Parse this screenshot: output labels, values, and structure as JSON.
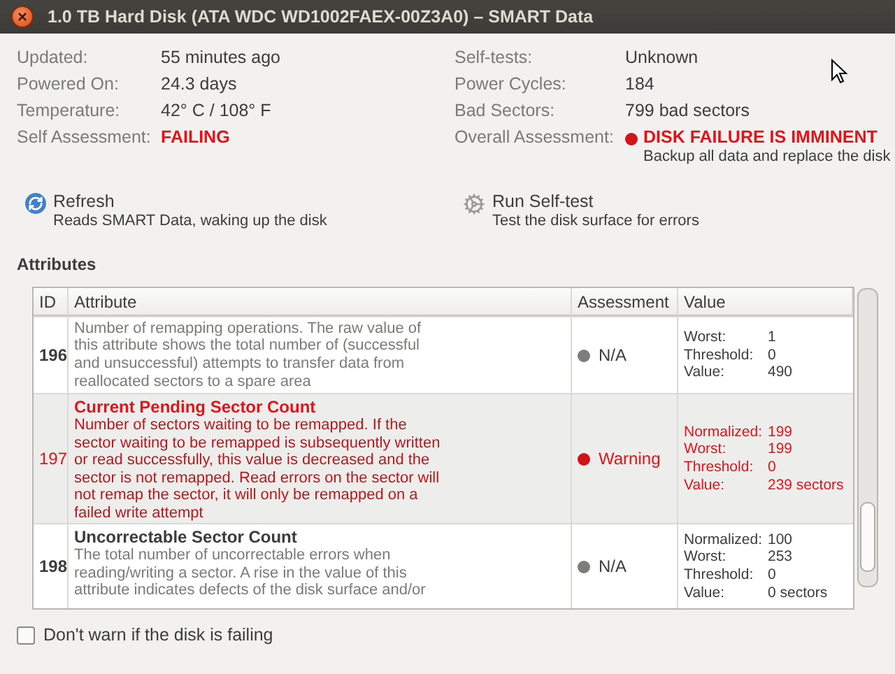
{
  "window": {
    "title": "1.0 TB Hard Disk (ATA WDC WD1002FAEX-00Z3A0) – SMART Data"
  },
  "info_left": [
    {
      "label": "Updated:",
      "value": "55 minutes ago",
      "alert": false
    },
    {
      "label": "Powered On:",
      "value": "24.3 days",
      "alert": false
    },
    {
      "label": "Temperature:",
      "value": "42° C / 108° F",
      "alert": false
    },
    {
      "label": "Self Assessment:",
      "value": "FAILING",
      "alert": true
    }
  ],
  "info_right": [
    {
      "label": "Self-tests:",
      "value": "Unknown",
      "alert": false
    },
    {
      "label": "Power Cycles:",
      "value": "184",
      "alert": false
    },
    {
      "label": "Bad Sectors:",
      "value": "799 bad sectors",
      "alert": false
    },
    {
      "label": "Overall Assessment:",
      "value": "DISK FAILURE IS IMMINENT",
      "note": "Backup all data and replace the disk",
      "alert": true
    }
  ],
  "actions": [
    {
      "kind": "refresh",
      "label": "Refresh",
      "description": "Reads SMART Data, waking up the disk"
    },
    {
      "kind": "selftest",
      "label": "Run Self-test",
      "description": "Test the disk surface for errors"
    }
  ],
  "attributes": {
    "heading": "Attributes",
    "columns": [
      "ID",
      "Attribute",
      "Assessment",
      "Value"
    ],
    "rows": [
      {
        "id": "196",
        "warning": false,
        "description": "Number of remapping operations. The raw value of this attribute shows the total number of (successful and unsuccessful) attempts to transfer data from reallocated sectors to a spare area",
        "assessment": {
          "kind": "na",
          "text": "N/A"
        },
        "values": [
          {
            "label": "Worst:",
            "value": "1"
          },
          {
            "label": "Threshold:",
            "value": "0"
          },
          {
            "label": "Value:",
            "value": "490"
          }
        ]
      },
      {
        "id": "197",
        "warning": true,
        "title": "Current Pending Sector Count",
        "description": "Number of sectors waiting to be remapped. If the sector waiting to be remapped is subsequently written or read successfully, this value is decreased and the sector is not remapped. Read errors on the sector will not remap the sector, it will only be remapped on a failed write attempt",
        "assessment": {
          "kind": "warning",
          "text": "Warning"
        },
        "values": [
          {
            "label": "Normalized:",
            "value": "199"
          },
          {
            "label": "Worst:",
            "value": "199"
          },
          {
            "label": "Threshold:",
            "value": "0"
          },
          {
            "label": "Value:",
            "value": "239 sectors"
          }
        ]
      },
      {
        "id": "198",
        "warning": false,
        "title": "Uncorrectable Sector Count",
        "description": "The total number of uncorrectable errors when reading/writing a sector. A rise in the value of this attribute indicates defects of the disk surface and/or",
        "assessment": {
          "kind": "na",
          "text": "N/A"
        },
        "values": [
          {
            "label": "Normalized:",
            "value": "100"
          },
          {
            "label": "Worst:",
            "value": "253"
          },
          {
            "label": "Threshold:",
            "value": "0"
          },
          {
            "label": "Value:",
            "value": "0 sectors"
          }
        ]
      }
    ]
  },
  "dont_warn": {
    "label": "Don't warn if the disk is failing",
    "checked": false
  }
}
